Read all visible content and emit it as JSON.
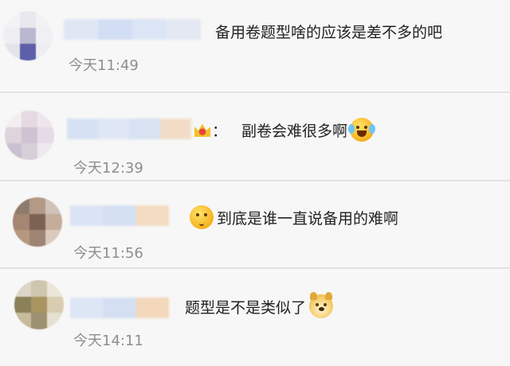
{
  "comments": [
    {
      "text": "备用卷题型啥的应该是差不多的吧",
      "time": "今天11:49",
      "prefix": ""
    },
    {
      "text": "副卷会难很多啊",
      "time": "今天12:39",
      "prefix": "：",
      "emoji_after": "laugh-cry-icon"
    },
    {
      "text": "到底是谁一直说备用的难啊",
      "time": "今天11:56",
      "prefix": "",
      "emoji_before": "pondering-face-icon"
    },
    {
      "text": "题型是不是类似了",
      "time": "今天14:11",
      "prefix": "",
      "emoji_after": "doge-icon"
    }
  ],
  "colors": {
    "background": "#f7f7f7",
    "divider": "#e2e2e2",
    "text": "#222222",
    "time": "#8e8e8e"
  }
}
